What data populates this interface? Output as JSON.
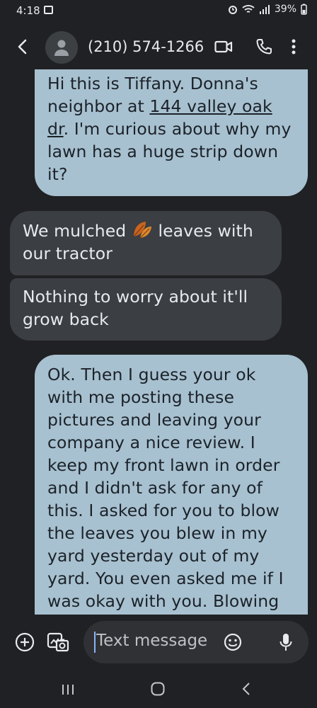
{
  "status_bar": {
    "time": "4:18",
    "battery": "39%"
  },
  "header": {
    "contact": "(210) 574-1266"
  },
  "messages": [
    {
      "direction": "outgoing",
      "segments": [
        "Hi this is Tiffany. Donna's neighbor at ",
        "144 valley oak dr",
        ". I'm curious about why my lawn has a huge strip down it?"
      ]
    },
    {
      "direction": "incoming",
      "segments": [
        "We mulched ",
        " leaves with our tractor"
      ]
    },
    {
      "direction": "incoming",
      "text": "Nothing to worry about it'll grow back"
    },
    {
      "direction": "outgoing",
      "text": "Ok. Then I guess your ok with me posting these pictures and leaving your company a nice review.  I keep my front lawn in order and I didn't ask for any of this.  I asked for you to blow the leaves you blew in my yard yesterday out of my yard.  You even asked me if I was okay with you. Blowing"
    }
  ],
  "compose": {
    "placeholder": "Text message"
  },
  "colors": {
    "outgoing_bubble": "#a8c1d0",
    "incoming_bubble": "#3b3e43",
    "background": "#202124"
  }
}
